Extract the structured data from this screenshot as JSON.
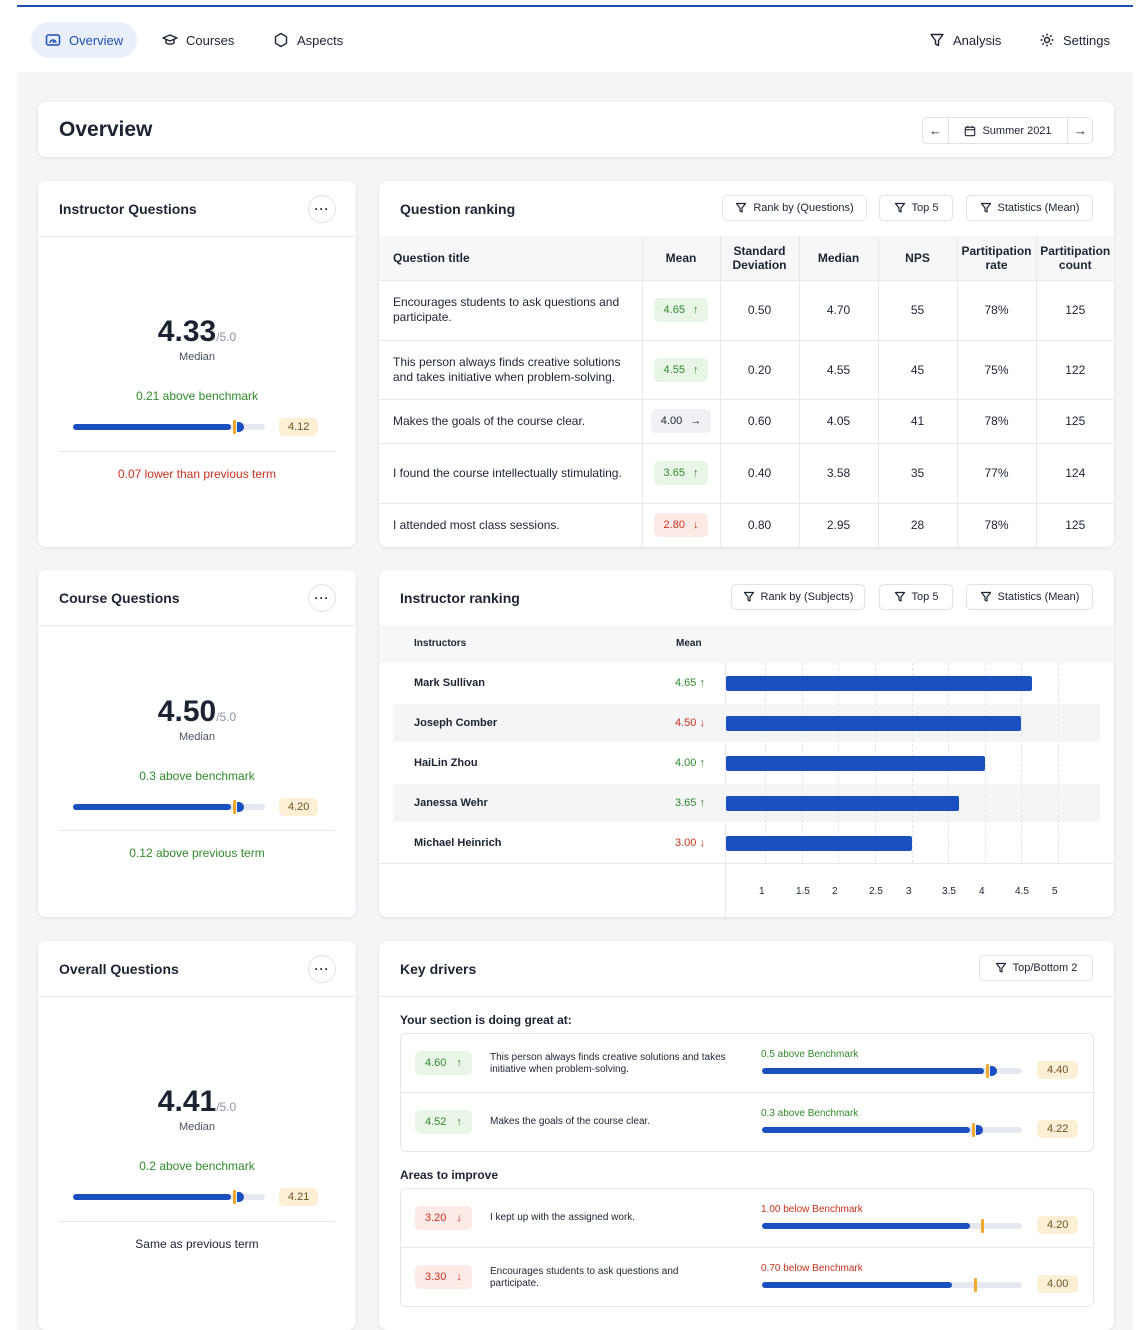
{
  "nav": {
    "overview": "Overview",
    "courses": "Courses",
    "aspects": "Aspects",
    "analysis": "Analysis",
    "settings": "Settings"
  },
  "page": {
    "title": "Overview",
    "term": "Summer 2021"
  },
  "instructor_questions": {
    "title": "Instructor Questions",
    "value": "4.33",
    "out_of": "/5.0",
    "label": "Median",
    "benchmark_text": "0.21 above benchmark",
    "benchmark_value": "4.12",
    "bar_fraction": 0.87,
    "previous": "0.07 lower than previous term"
  },
  "course_questions": {
    "title": "Course Questions",
    "value": "4.50",
    "out_of": "/5.0",
    "label": "Median",
    "benchmark_text": "0.3 above benchmark",
    "benchmark_value": "4.20",
    "bar_fraction": 0.87,
    "previous": "0.12 above previous term"
  },
  "overall_questions": {
    "title": "Overall Questions",
    "value": "4.41",
    "out_of": "/5.0",
    "label": "Median",
    "benchmark_text": "0.2 above benchmark",
    "benchmark_value": "4.21",
    "bar_fraction": 0.87,
    "previous": "Same as previous term"
  },
  "question_ranking": {
    "title": "Question ranking",
    "filters": [
      "Rank by (Questions)",
      "Top 5",
      "Statistics (Mean)"
    ],
    "columns": [
      "Question title",
      "Mean",
      "Standard Deviation",
      "Median",
      "NPS",
      "Partitipation rate",
      "Partitipation count"
    ],
    "rows": [
      {
        "title": "Encourages students to ask questions and participate.",
        "mean": "4.65",
        "trend": "up",
        "sd": "0.50",
        "median": "4.70",
        "nps": "55",
        "rate": "78%",
        "count": "125"
      },
      {
        "title": "This person always finds creative solutions and takes initiative when problem-solving.",
        "mean": "4.55",
        "trend": "up",
        "sd": "0.20",
        "median": "4.55",
        "nps": "45",
        "rate": "75%",
        "count": "122"
      },
      {
        "title": "Makes the goals of the course clear.",
        "mean": "4.00",
        "trend": "flat",
        "sd": "0.60",
        "median": "4.05",
        "nps": "41",
        "rate": "78%",
        "count": "125"
      },
      {
        "title": "I found the course intellectually stimulating.",
        "mean": "3.65",
        "trend": "up",
        "sd": "0.40",
        "median": "3.58",
        "nps": "35",
        "rate": "77%",
        "count": "124"
      },
      {
        "title": "I attended most class sessions.",
        "mean": "2.80",
        "trend": "down",
        "sd": "0.80",
        "median": "2.95",
        "nps": "28",
        "rate": "78%",
        "count": "125"
      }
    ]
  },
  "instructor_ranking": {
    "title": "Instructor ranking",
    "filters": [
      "Rank by (Subjects)",
      "Top 5",
      "Statistics (Mean)"
    ],
    "col_instructors": "Instructors",
    "col_mean": "Mean",
    "rows": [
      {
        "name": "Mark Sullivan",
        "mean": "4.65",
        "trend": "up",
        "value": 4.65
      },
      {
        "name": "Joseph Comber",
        "mean": "4.50",
        "trend": "down",
        "value": 4.5
      },
      {
        "name": "HaiLin Zhou",
        "mean": "4.00",
        "trend": "up",
        "value": 4.0
      },
      {
        "name": "Janessa Wehr",
        "mean": "3.65",
        "trend": "up",
        "value": 3.65
      },
      {
        "name": "Michael Heinrich",
        "mean": "3.00",
        "trend": "down",
        "value": 3.0
      }
    ],
    "ticks": [
      "1",
      "1.5",
      "2",
      "2.5",
      "3",
      "3.5",
      "4",
      "4.5",
      "5"
    ],
    "tick_values": [
      1,
      1.5,
      2,
      2.5,
      3,
      3.5,
      4,
      4.5,
      5
    ]
  },
  "key_drivers": {
    "title": "Key drivers",
    "filter": "Top/Bottom 2",
    "great_label": "Your section is doing great at:",
    "improve_label": "Areas to improve",
    "great": [
      {
        "score": "4.60",
        "text": "This person always finds creative solutions and takes initiative when problem-solving.",
        "bench_text": "0.5 above Benchmark",
        "bench_value": "4.40",
        "fraction": 0.86
      },
      {
        "score": "4.52",
        "text": "Makes the goals of the course clear.",
        "bench_text": "0.3 above Benchmark",
        "bench_value": "4.22",
        "fraction": 0.81
      }
    ],
    "improve": [
      {
        "score": "3.20",
        "text": "I kept up with the assigned work.",
        "bench_text": "1.00 below Benchmark",
        "bench_value": "4.20",
        "fraction": 0.8
      },
      {
        "score": "3.30",
        "text": "Encourages students to ask questions and participate.",
        "bench_text": "0.70 below Benchmark",
        "bench_value": "4.00",
        "fraction": 0.73
      }
    ]
  },
  "colors": {
    "accent": "#1e4fb5",
    "bar": "#1a4fc0",
    "positive": "#2f8a2a",
    "negative": "#c8321f",
    "benchmark": "#f0a830"
  }
}
